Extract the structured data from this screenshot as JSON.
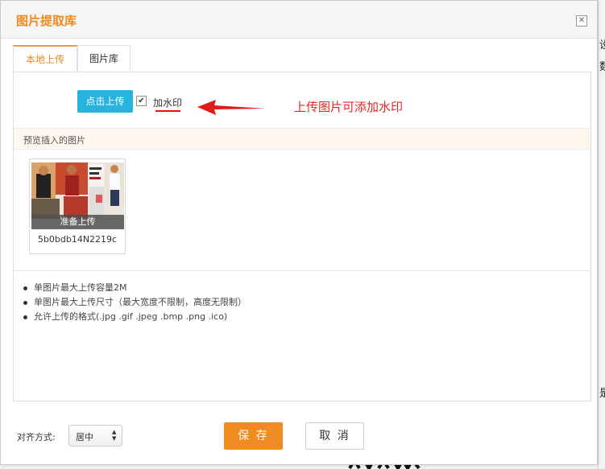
{
  "dialog": {
    "title": "图片提取库"
  },
  "tabs": [
    {
      "label": "本地上传",
      "active": true
    },
    {
      "label": "图片库",
      "active": false
    }
  ],
  "upload": {
    "button_label": "点击上传",
    "watermark_checked": true,
    "watermark_label": "加水印"
  },
  "annotation": {
    "text": "上传图片可添加水印",
    "color": "#e82525"
  },
  "preview": {
    "title": "预览插入的图片",
    "items": [
      {
        "status": "准备上传",
        "filename": "5b0bdb14N2219c"
      }
    ]
  },
  "notes": [
    "单图片最大上传容量2M",
    "单图片最大上传尺寸（最大宽度不限制，高度无限制）",
    "允许上传的格式(.jpg .gif .jpeg .bmp .png .ico)"
  ],
  "footer": {
    "align_label": "对齐方式:",
    "align_value": "居中",
    "save_label": "保 存",
    "cancel_label": "取 消"
  },
  "background": {
    "right_chars": [
      "设",
      "数",
      "是"
    ]
  },
  "colors": {
    "accent": "#f08c1f",
    "upload_button": "#28b3dd"
  }
}
